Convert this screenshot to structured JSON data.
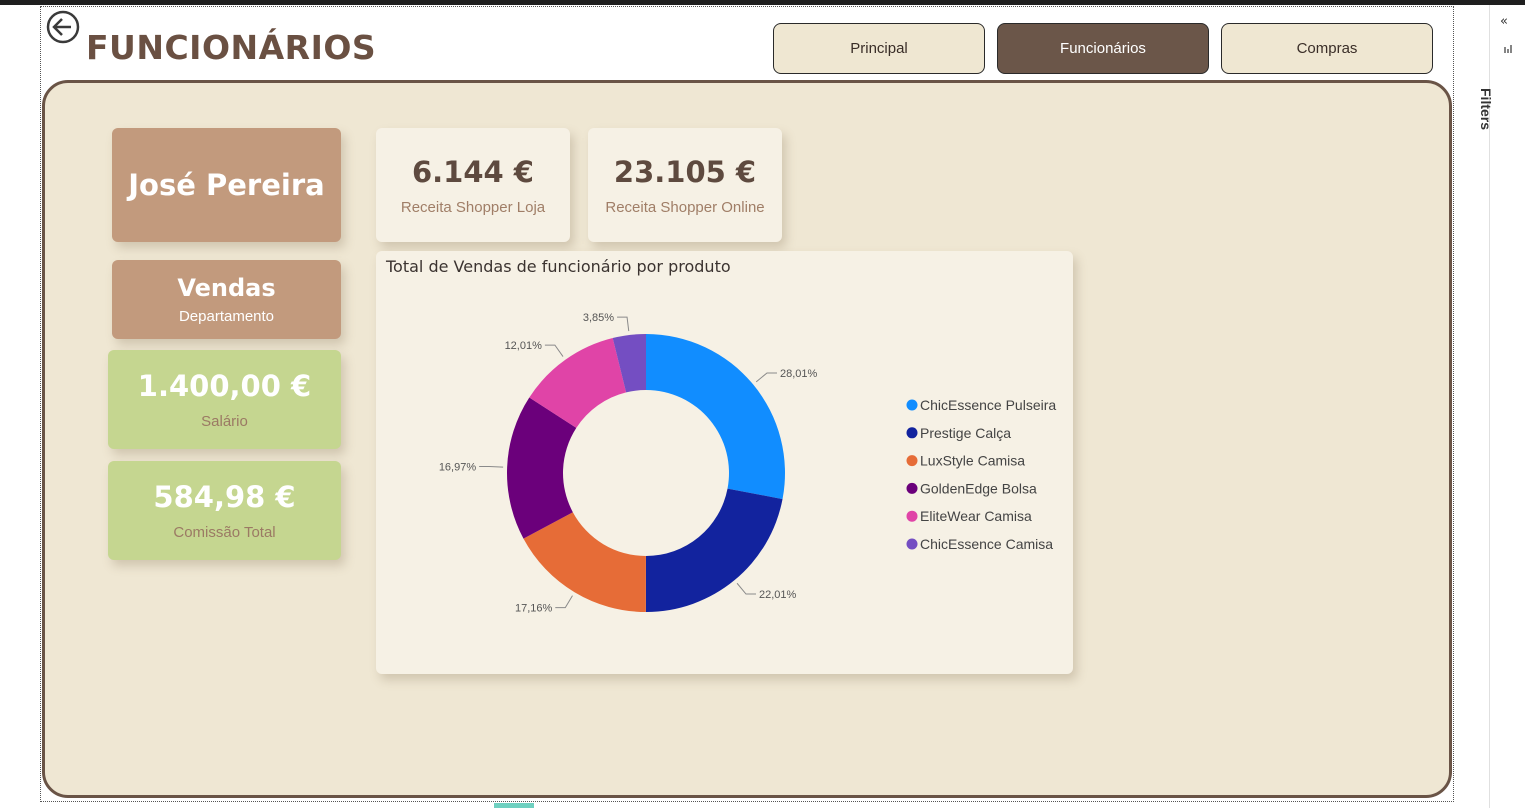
{
  "header": {
    "title": "FUNCIONÁRIOS",
    "back_icon": "arrow-left-circle-icon",
    "nav": [
      {
        "label": "Principal",
        "active": false
      },
      {
        "label": "Funcionários",
        "active": true
      },
      {
        "label": "Compras",
        "active": false
      }
    ]
  },
  "employee": {
    "name": "José Pereira",
    "department_value": "Vendas",
    "department_label": "Departamento",
    "salary_value": "1.400,00 €",
    "salary_label": "Salário",
    "commission_value": "584,98 €",
    "commission_label": "Comissão Total"
  },
  "kpis": {
    "store_value": "6.144 €",
    "store_label": "Receita Shopper Loja",
    "online_value": "23.105 €",
    "online_label": "Receita Shopper Online"
  },
  "chart_data": {
    "type": "donut",
    "title": "Total de Vendas de funcionário por produto",
    "legend_position": "right",
    "categories": [
      "ChicEssence Pulseira",
      "Prestige Calça",
      "LuxStyle Camisa",
      "GoldenEdge Bolsa",
      "EliteWear Camisa",
      "ChicEssence Camisa"
    ],
    "values": [
      28.01,
      22.01,
      17.16,
      16.97,
      12.01,
      3.85
    ],
    "labels": [
      "28,01%",
      "22,01%",
      "17,16%",
      "16,97%",
      "12,01%",
      "3,85%"
    ],
    "colors": [
      "#118dff",
      "#12239e",
      "#e66c37",
      "#6b007b",
      "#e044a7",
      "#744ec2"
    ]
  },
  "right_pane": {
    "label": "Filters",
    "collapse_icon": "chevron-double-left-icon",
    "filter_icon": "filter-icon"
  },
  "theme": {
    "accent_brown": "#6b5649",
    "card_brown": "#c29a7d",
    "card_green": "#c5d690",
    "panel_bg": "#efe7d3"
  }
}
